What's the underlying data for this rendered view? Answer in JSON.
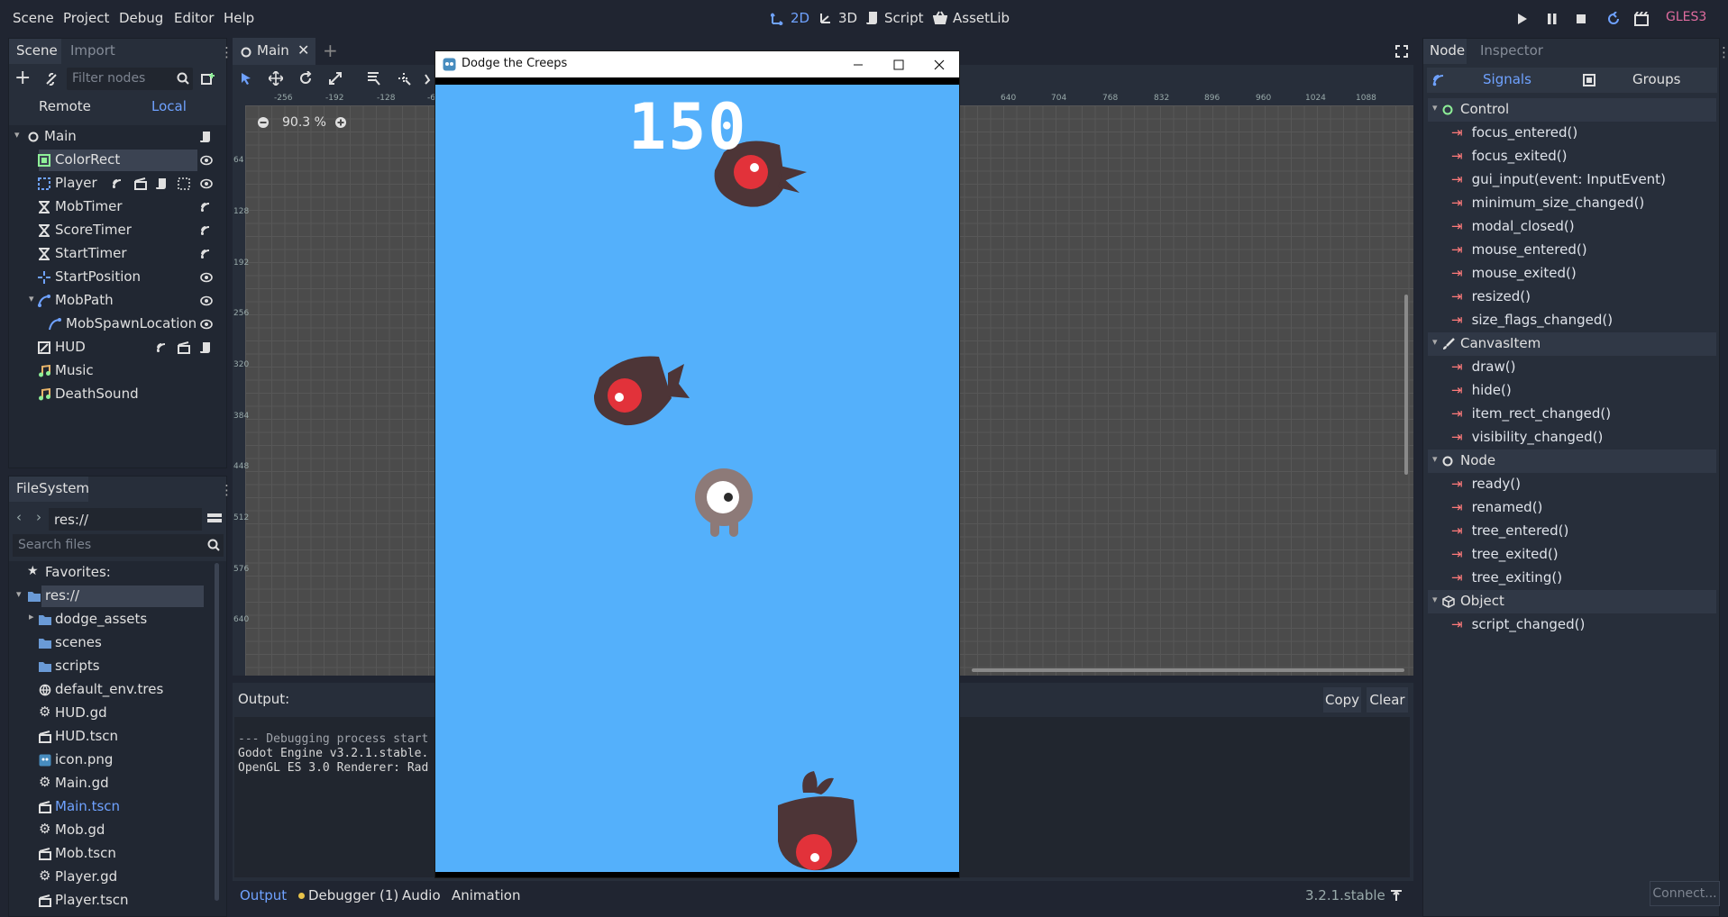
{
  "menubar": {
    "items": [
      "Scene",
      "Project",
      "Debug",
      "Editor",
      "Help"
    ],
    "modes": {
      "m2d": "2D",
      "m3d": "3D",
      "script": "Script",
      "assetlib": "AssetLib"
    },
    "renderer": "GLES3"
  },
  "scene_dock": {
    "tab_scene": "Scene",
    "tab_import": "Import",
    "filter_placeholder": "Filter nodes",
    "remote": "Remote",
    "local": "Local",
    "nodes": [
      "Main",
      "ColorRect",
      "Player",
      "MobTimer",
      "ScoreTimer",
      "StartTimer",
      "StartPosition",
      "MobPath",
      "MobSpawnLocation",
      "HUD",
      "Music",
      "DeathSound"
    ]
  },
  "filesystem": {
    "title": "FileSystem",
    "path": "res://",
    "search_placeholder": "Search files",
    "favorites": "Favorites:",
    "items": [
      "res://",
      "dodge_assets",
      "scenes",
      "scripts",
      "default_env.tres",
      "HUD.gd",
      "HUD.tscn",
      "icon.png",
      "Main.gd",
      "Main.tscn",
      "Mob.gd",
      "Mob.tscn",
      "Player.gd",
      "Player.tscn"
    ]
  },
  "editor": {
    "tab": "Main",
    "zoom": "90.3 %",
    "ruler_top": [
      "-256",
      "-192",
      "-128",
      "-6",
      "640",
      "704",
      "768",
      "832",
      "896",
      "960",
      "1024",
      "1088"
    ],
    "ruler_left": [
      "64",
      "128",
      "192",
      "256",
      "320",
      "384",
      "448",
      "512",
      "576",
      "640"
    ]
  },
  "output": {
    "label": "Output:",
    "copy": "Copy",
    "clear": "Clear",
    "lines": [
      "--- Debugging process start",
      "Godot Engine v3.2.1.stable.",
      "OpenGL ES 3.0 Renderer: Rad"
    ],
    "bottom_tabs": {
      "output": "Output",
      "debugger": "Debugger (1)",
      "audio": "Audio",
      "animation": "Animation"
    },
    "version": "3.2.1.stable"
  },
  "game": {
    "title": "Dodge the Creeps",
    "score": "150",
    "bg": "#54b0fb"
  },
  "node_dock": {
    "tab_node": "Node",
    "tab_inspector": "Inspector",
    "signals": "Signals",
    "groups": "Groups",
    "connect": "Connect...",
    "sections": [
      {
        "name": "Control",
        "signals": [
          "focus_entered()",
          "focus_exited()",
          "gui_input(event: InputEvent)",
          "minimum_size_changed()",
          "modal_closed()",
          "mouse_entered()",
          "mouse_exited()",
          "resized()",
          "size_flags_changed()"
        ]
      },
      {
        "name": "CanvasItem",
        "signals": [
          "draw()",
          "hide()",
          "item_rect_changed()",
          "visibility_changed()"
        ]
      },
      {
        "name": "Node",
        "signals": [
          "ready()",
          "renamed()",
          "tree_entered()",
          "tree_exited()",
          "tree_exiting()"
        ]
      },
      {
        "name": "Object",
        "signals": [
          "script_changed()"
        ]
      }
    ]
  },
  "colors": {
    "accent": "#6fa2ff",
    "signal": "#ff7a7a",
    "bg": "#202531",
    "panel": "#272e3a"
  }
}
